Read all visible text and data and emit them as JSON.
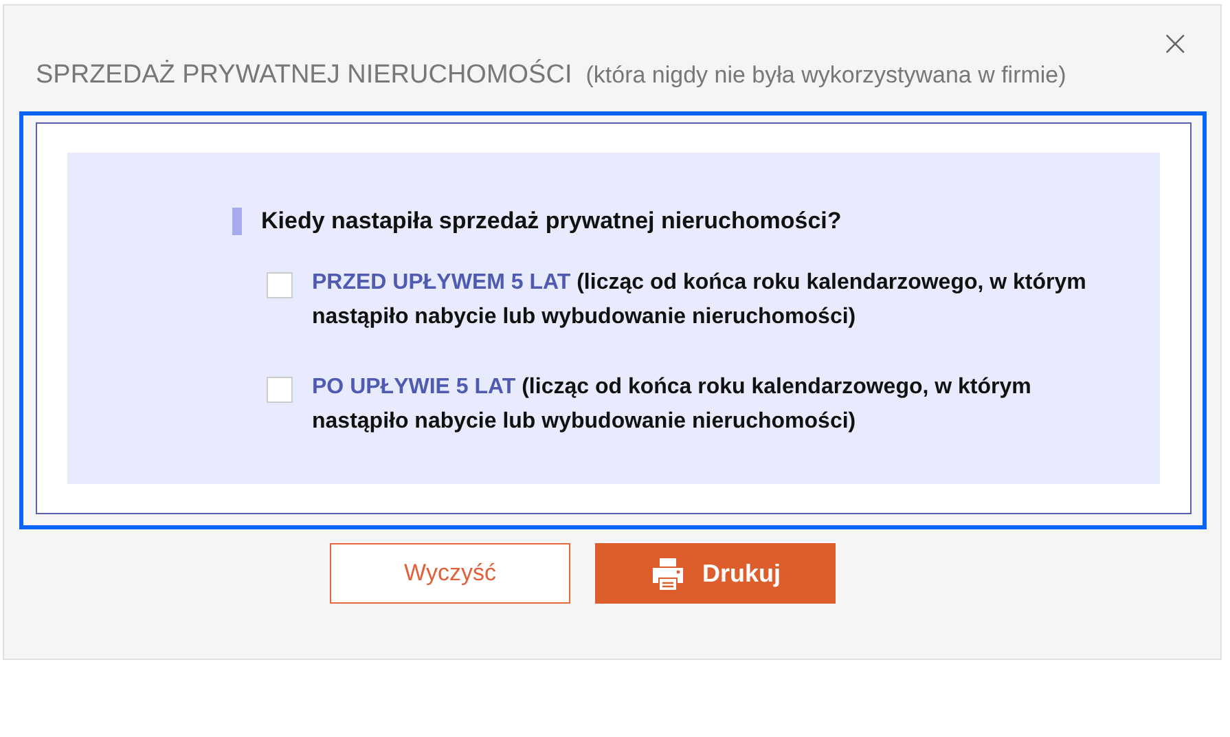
{
  "dialog": {
    "title": "SPRZEDAŻ PRYWATNEJ NIERUCHOMOŚCI",
    "subtitle": "(która nigdy nie była wykorzystywana w firmie)",
    "close": "×"
  },
  "question": "Kiedy nastapiła sprzedaż prywatnej nieruchomości?",
  "options": [
    {
      "highlight": "PRZED UPŁYWEM 5 LAT",
      "text": "(licząc od końca roku kalendarzowego, w którym nastąpiło nabycie lub wybudowanie nieruchomości)",
      "checked": false
    },
    {
      "highlight": "PO UPŁYWIE 5 LAT",
      "text": "(licząc od końca roku kalendarzowego, w którym nastąpiło nabycie lub wybudowanie nieruchomości)",
      "checked": false
    }
  ],
  "buttons": [
    {
      "label": "Wyczyść",
      "kind": "outline"
    },
    {
      "label": "Drukuj",
      "kind": "print"
    }
  ]
}
